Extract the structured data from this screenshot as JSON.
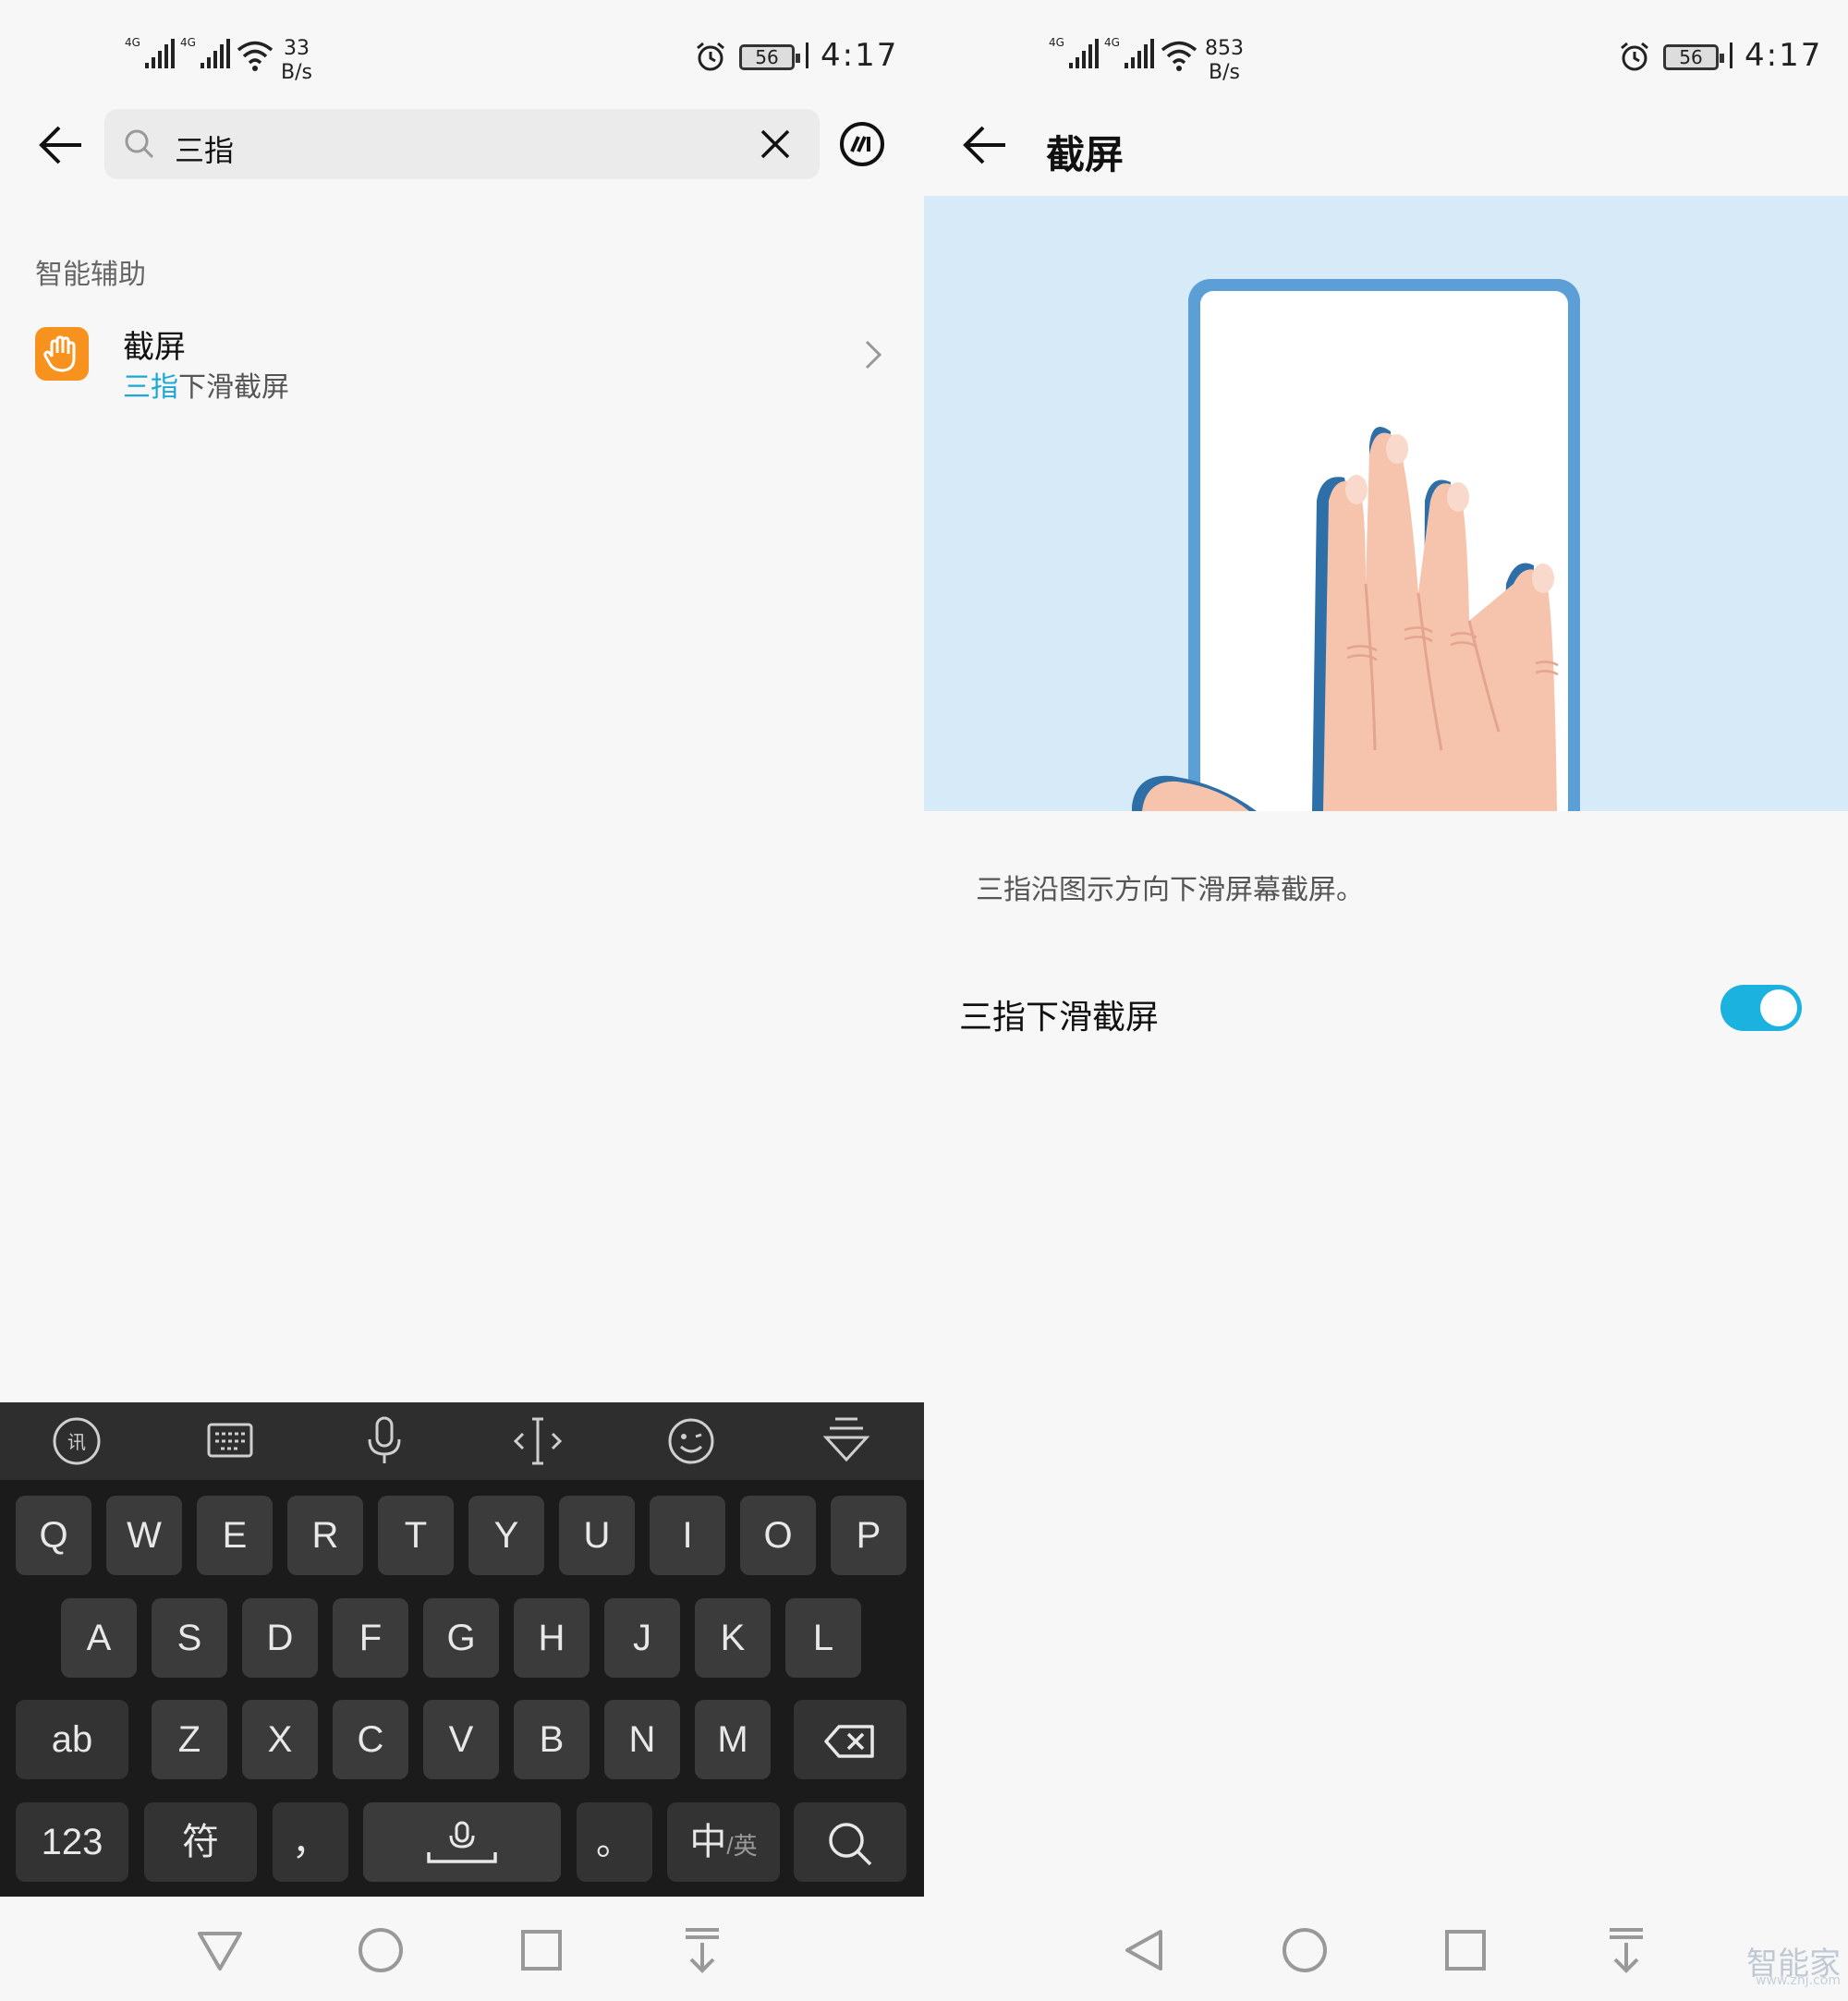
{
  "left": {
    "status": {
      "net_speed_value": "33",
      "net_speed_unit": "B/s",
      "battery": "56",
      "time": "4:17",
      "signal1": "4G",
      "signal2": "4G"
    },
    "search": {
      "query": "三指"
    },
    "section_label": "智能辅助",
    "result": {
      "title": "截屏",
      "subtitle_highlight": "三指",
      "subtitle_rest": "下滑截屏"
    },
    "keyboard": {
      "row1": [
        "Q",
        "W",
        "E",
        "R",
        "T",
        "Y",
        "U",
        "I",
        "O",
        "P"
      ],
      "row2": [
        "A",
        "S",
        "D",
        "F",
        "G",
        "H",
        "J",
        "K",
        "L"
      ],
      "row3": [
        "Z",
        "X",
        "C",
        "V",
        "B",
        "N",
        "M"
      ],
      "ab": "ab",
      "num": "123",
      "symbol": "符",
      "comma": "，",
      "period": "。",
      "lang_main": "中",
      "lang_alt": "/英"
    }
  },
  "right": {
    "status": {
      "net_speed_value": "853",
      "net_speed_unit": "B/s",
      "battery": "56",
      "time": "4:17",
      "signal1": "4G",
      "signal2": "4G"
    },
    "title": "截屏",
    "description": "三指沿图示方向下滑屏幕截屏。",
    "toggle": {
      "label": "三指下滑截屏",
      "on": true
    },
    "watermark": "智能家",
    "watermark_url": "www.znj.com"
  },
  "colors": {
    "accent": "#1bb2e0",
    "highlight": "#1ba8d6",
    "app_icon": "#f7921e",
    "keyboard_bg": "#1b1b1b",
    "key_bg": "#3b3b3b"
  }
}
